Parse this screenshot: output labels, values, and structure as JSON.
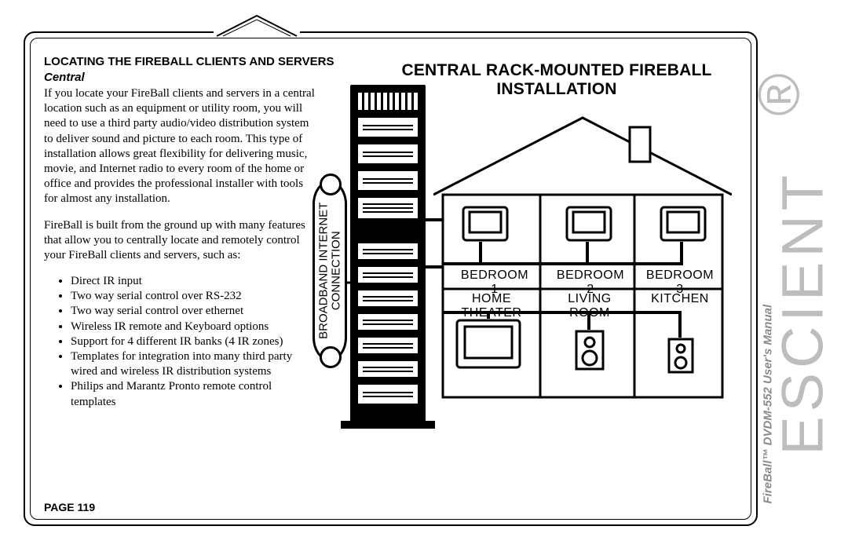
{
  "heading": "LOCATING THE FIREBALL CLIENTS AND SERVERS",
  "subhead": "Central",
  "para1": "If you locate your FireBall clients and servers in a central location such as an equipment or utility room, you will need to use a third party audio/video distribution system to deliver sound and picture to each room. This type of installation allows great flexibility for delivering music, movie, and Internet radio to every room of the home or office and provides the professional installer with tools for almost any installation.",
  "para2": "FireBall is built from the ground up with many features that allow you to centrally locate and remotely control your FireBall clients and servers, such as:",
  "bullets": [
    "Direct IR input",
    "Two way serial control over RS-232",
    "Two way serial control over ethernet",
    "Wireless IR remote and Keyboard options",
    "Support for 4 different IR banks (4 IR zones)",
    "Templates for integration into many third party wired and wireless IR distribution systems",
    "Philips and Marantz Pronto remote control templates"
  ],
  "page_label": "PAGE 119",
  "brand": "ESCIENT",
  "brand_reg": "®",
  "side_sub": "FireBall™ DVDM-552 User's Manual",
  "diagram": {
    "title": "CENTRAL RACK-MOUNTED FIREBALL INSTALLATION",
    "broadband_line1": "BROADBAND INTERNET",
    "broadband_line2": "CONNECTION",
    "rooms_top": [
      "BEDROOM 1",
      "BEDROOM 2",
      "BEDROOM 3"
    ],
    "rooms_bottom": [
      "HOME THEATER",
      "LIVING ROOM",
      "KITCHEN"
    ]
  }
}
